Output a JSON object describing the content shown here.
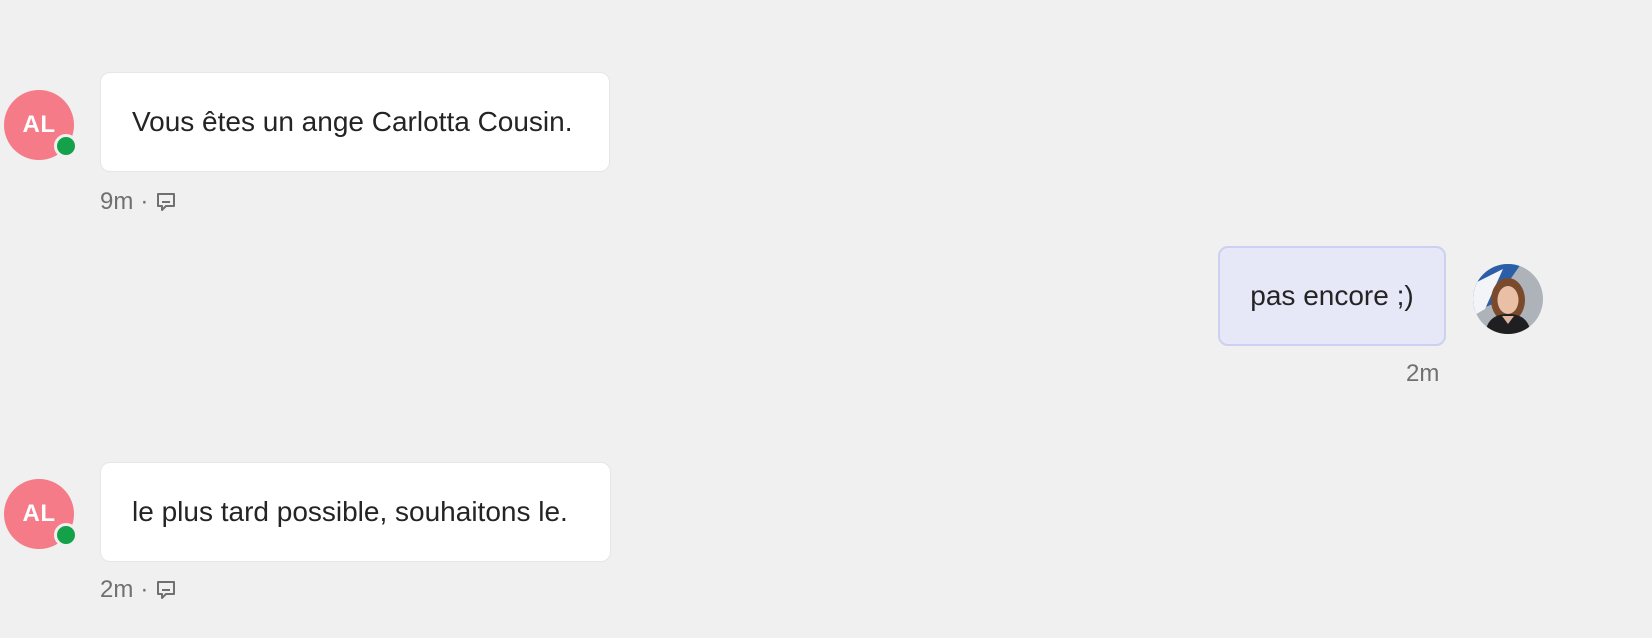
{
  "messages": [
    {
      "sender_initials": "AL",
      "text": "Vous êtes un ange Carlotta Cousin.",
      "time": "9m",
      "separator": "·",
      "reply_icon": "chat-bubble-reply-icon"
    },
    {
      "text": "pas encore ;)",
      "time": "2m"
    },
    {
      "sender_initials": "AL",
      "text": "le plus tard possible, souhaitons le.",
      "time": "2m",
      "separator": "·",
      "reply_icon": "chat-bubble-reply-icon"
    }
  ],
  "colors": {
    "background": "#f0f0f0",
    "avatar_initials_bg": "#f57b88",
    "presence_available": "#13a14a",
    "incoming_bubble": "#ffffff",
    "outgoing_bubble": "#e6e8f8",
    "outgoing_border": "#cdd0ee",
    "meta_text": "#707070"
  }
}
